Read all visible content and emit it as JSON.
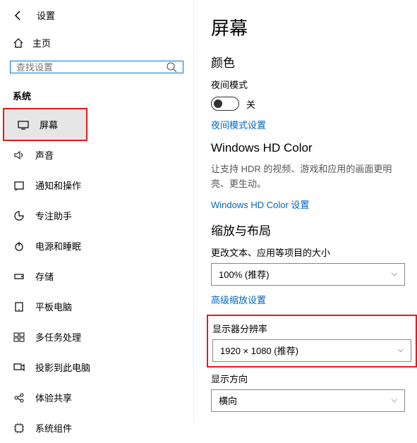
{
  "header": {
    "title": "设置"
  },
  "sidebar": {
    "home_label": "主页",
    "search_placeholder": "查找设置",
    "section_label": "系统",
    "items": [
      {
        "label": "屏幕"
      },
      {
        "label": "声音"
      },
      {
        "label": "通知和操作"
      },
      {
        "label": "专注助手"
      },
      {
        "label": "电源和睡眠"
      },
      {
        "label": "存储"
      },
      {
        "label": "平板电脑"
      },
      {
        "label": "多任务处理"
      },
      {
        "label": "投影到此电脑"
      },
      {
        "label": "体验共享"
      },
      {
        "label": "系统组件"
      }
    ]
  },
  "main": {
    "page_title": "屏幕",
    "color_section": "颜色",
    "night_mode_label": "夜间模式",
    "toggle_off": "关",
    "night_mode_settings": "夜间模式设置",
    "hdcolor_title": "Windows HD Color",
    "hdcolor_desc": "让支持 HDR 的视频、游戏和应用的画面更明亮、更生动。",
    "hdcolor_link": "Windows HD Color 设置",
    "scale_section": "缩放与布局",
    "textsize_label": "更改文本、应用等项目的大小",
    "textsize_value": "100% (推荐)",
    "advanced_scale": "高级缩放设置",
    "resolution_label": "显示器分辨率",
    "resolution_value": "1920 × 1080 (推荐)",
    "orientation_label": "显示方向",
    "orientation_value": "横向"
  }
}
